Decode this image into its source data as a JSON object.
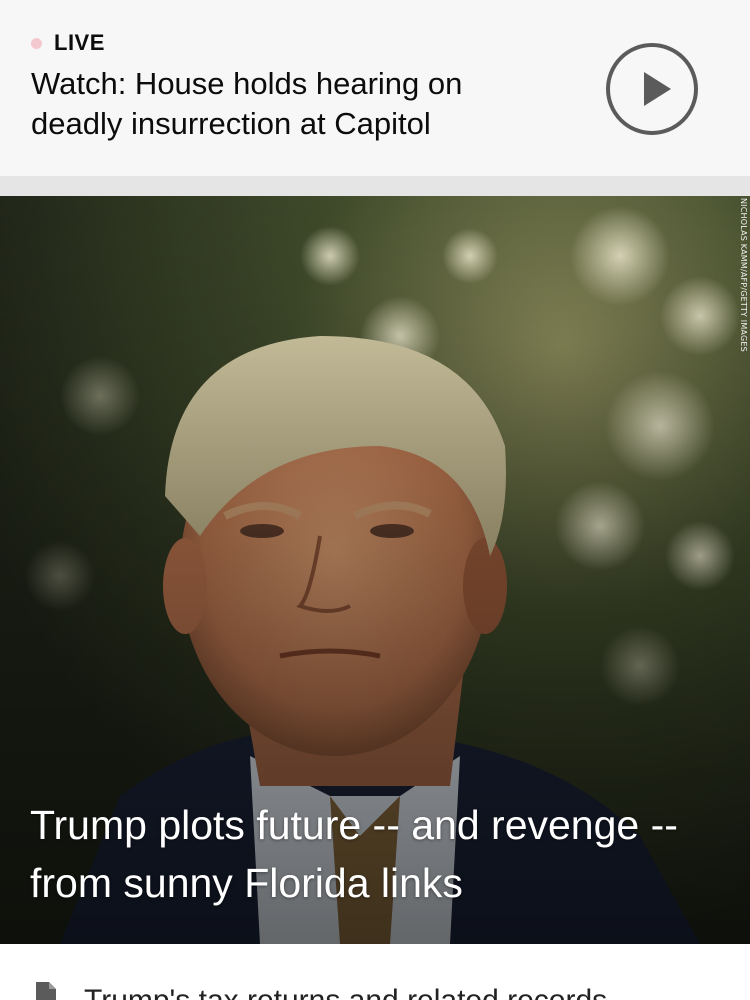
{
  "live_card": {
    "badge": "LIVE",
    "headline": "Watch: House holds hearing on deadly insurrection at Capitol",
    "play_icon": "play-circle-icon",
    "badge_dot_color": "#f4c8cf"
  },
  "hero": {
    "caption": "Trump plots future -- and revenge -- from sunny Florida links",
    "photo_credit": "NICHOLAS KAMM/AFP/GETTY IMAGES"
  },
  "article_list": {
    "first_item_icon": "document-icon",
    "first_item_text": "Trump's tax returns and related records"
  }
}
